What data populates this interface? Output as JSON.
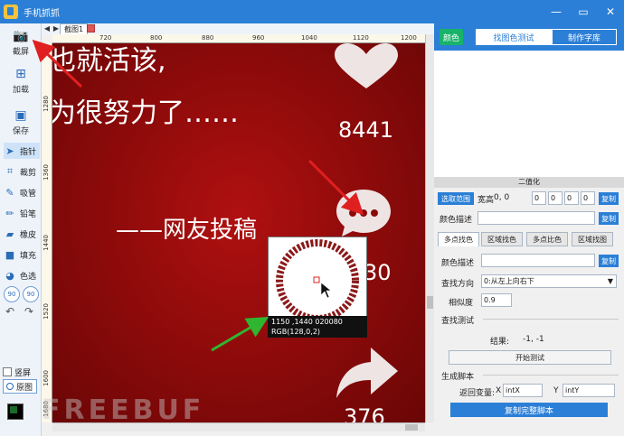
{
  "app": {
    "title": "手机抓抓"
  },
  "window_buttons": {
    "minimize": "—",
    "maximize": "▭",
    "close": "✕"
  },
  "left_toolbar": {
    "screenshot": "截屏",
    "load": "加载",
    "save": "保存",
    "tools": [
      "指针",
      "裁剪",
      "吸管",
      "铅笔",
      "橡皮",
      "填充",
      "色选"
    ],
    "rotate_left": "90",
    "rotate_right": "90",
    "portrait_label": "竖屏",
    "original_label": "原图"
  },
  "canvas": {
    "tab_label": "截图1",
    "ruler_h": [
      "720",
      "800",
      "880",
      "960",
      "1040",
      "1120",
      "1200"
    ],
    "ruler_v": [
      "1280",
      "1360",
      "1440",
      "1520",
      "1600",
      "1680"
    ],
    "phone_text": {
      "line1": "也就活该,",
      "line2": "为很努力了……",
      "line3": "——网友投稿"
    },
    "counts": {
      "likes": "8441",
      "comments": "30",
      "shares": "376"
    },
    "magnifier": {
      "coords": "1150 ,1440  020080",
      "rgb": "RGB(128,0,2)"
    }
  },
  "right_panel": {
    "color_button": "颜色",
    "tabs": [
      "找图色测试",
      "制作字库"
    ],
    "binarize_label": "二值化",
    "select_range_button": "选取范围",
    "width_height_label": "宽高",
    "width_height_value": "0, 0",
    "range_values": [
      "0",
      "0",
      "0",
      "0"
    ],
    "copy_label": "复制",
    "color_desc_label": "颜色描述",
    "subtabs": [
      "多点找色",
      "区域找色",
      "多点比色",
      "区域找图"
    ],
    "find_direction_label": "查找方向",
    "find_direction_value": "0:从左上向右下",
    "similarity_label": "相似度",
    "similarity_value": "0.9",
    "find_test_label": "查找测试",
    "result_label": "结果:",
    "result_value": "-1, -1",
    "start_test_button": "开始测试",
    "gen_script_label": "生成脚本",
    "return_var_label": "返回变量:",
    "x_label": "X",
    "x_value": "intX",
    "y_label": "Y",
    "y_value": "intY",
    "copy_script_button": "复制完整脚本"
  },
  "watermark": "FREEBUF",
  "colors": {
    "accent": "#2b7fd6",
    "phone_bg": "#8a0a0a",
    "color_btn": "#18b36a",
    "arrow_red": "#e02020",
    "arrow_green": "#2fb52f"
  }
}
